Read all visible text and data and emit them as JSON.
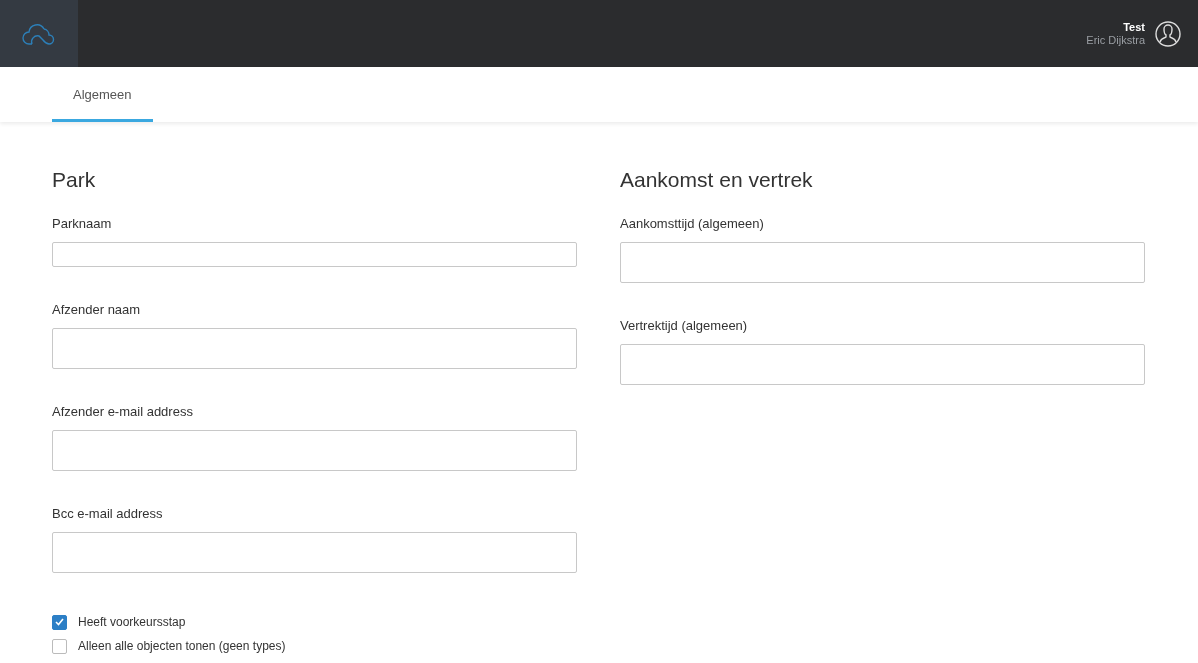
{
  "header": {
    "account": "Test",
    "user": "Eric Dijkstra"
  },
  "tabs": [
    {
      "label": "Algemeen",
      "selected": true
    }
  ],
  "sections": [
    {
      "title": "Park",
      "fields": [
        {
          "label": "Parknaam",
          "kind": "compact"
        },
        {
          "label": "Afzender naam",
          "kind": "tall"
        },
        {
          "label": "Afzender e-mail address",
          "kind": "tall"
        },
        {
          "label": "Bcc e-mail address",
          "kind": "tall"
        }
      ],
      "checkboxes": [
        {
          "label": "Heeft voorkeursstap",
          "checked": true
        },
        {
          "label": "Alleen alle objecten tonen (geen types)",
          "checked": false
        }
      ]
    },
    {
      "title": "Aankomst en vertrek",
      "fields": [
        {
          "label": "Aankomsttijd (algemeen)",
          "kind": "tall"
        },
        {
          "label": "Vertrektijd (algemeen)",
          "kind": "tall"
        }
      ]
    }
  ]
}
